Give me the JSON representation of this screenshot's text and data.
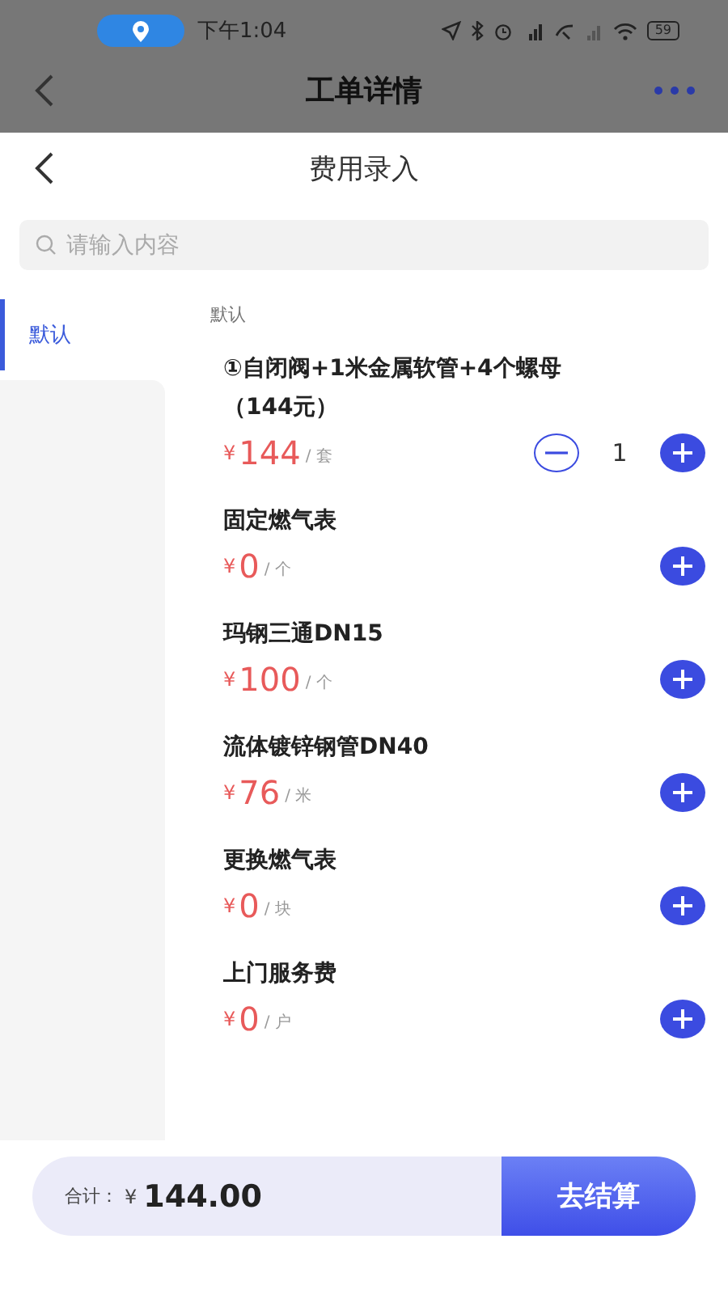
{
  "status_bar": {
    "time": "下午1:04",
    "battery": "59"
  },
  "header": {
    "title": "工单详情"
  },
  "sheet": {
    "title": "费用录入",
    "search": {
      "placeholder": "请输入内容"
    },
    "categories": [
      {
        "label": "默认",
        "selected": true
      }
    ],
    "section_title": "默认",
    "items": [
      {
        "name": "①自闭阀+1米金属软管+4个螺母（144元）",
        "currency": "¥",
        "price": "144",
        "unit": "/ 套",
        "quantity": "1"
      },
      {
        "name": "固定燃气表",
        "currency": "¥",
        "price": "0",
        "unit": "/ 个"
      },
      {
        "name": "玛钢三通DN15",
        "currency": "¥",
        "price": "100",
        "unit": "/ 个"
      },
      {
        "name": "流体镀锌钢管DN40",
        "currency": "¥",
        "price": "76",
        "unit": "/ 米"
      },
      {
        "name": "更换燃气表",
        "currency": "¥",
        "price": "0",
        "unit": "/ 块"
      },
      {
        "name": "上门服务费",
        "currency": "¥",
        "price": "0",
        "unit": "/ 户"
      }
    ]
  },
  "footer": {
    "total_label": "合计：",
    "currency": "¥",
    "total": "144.00",
    "checkout": "去结算"
  }
}
